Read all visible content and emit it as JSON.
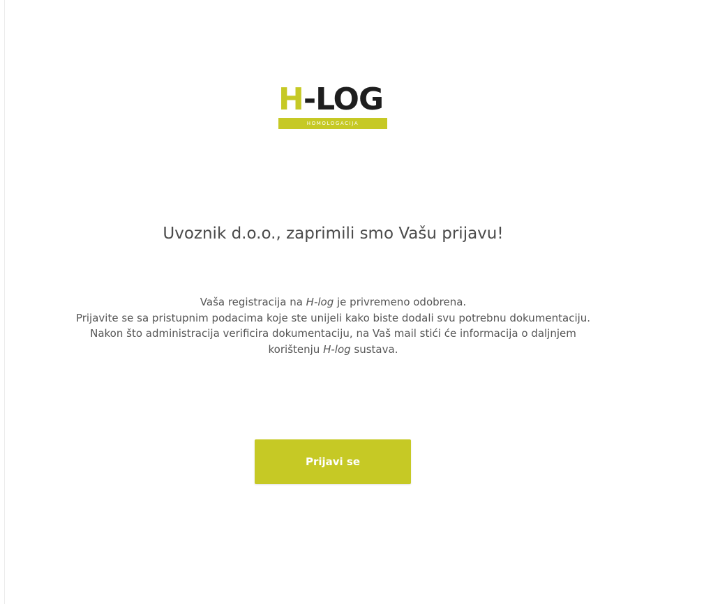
{
  "logo": {
    "letter_h": "H",
    "rest": "-LOG",
    "tagline": "HOMOLOGACIJA"
  },
  "heading": "Uvoznik d.o.o., zaprimili smo Vašu prijavu!",
  "message": {
    "line1_prefix": "Vaša registracija na ",
    "line1_brand": "H-log",
    "line1_suffix": " je privremeno odobrena.",
    "line2": "Prijavite se sa pristupnim podacima koje ste unijeli kako biste dodali svu potrebnu dokumentaciju.",
    "line3_prefix": "Nakon što administracija verificira dokumentaciju, na Vaš mail stići će informacija o daljnjem korištenju ",
    "line3_brand": "H-log",
    "line3_suffix": " sustava."
  },
  "button": {
    "label": "Prijavi se"
  },
  "colors": {
    "accent": "#c6c925",
    "text": "#4b4b4b",
    "logo_dark": "#1e1e1e",
    "background": "#ffffff"
  }
}
